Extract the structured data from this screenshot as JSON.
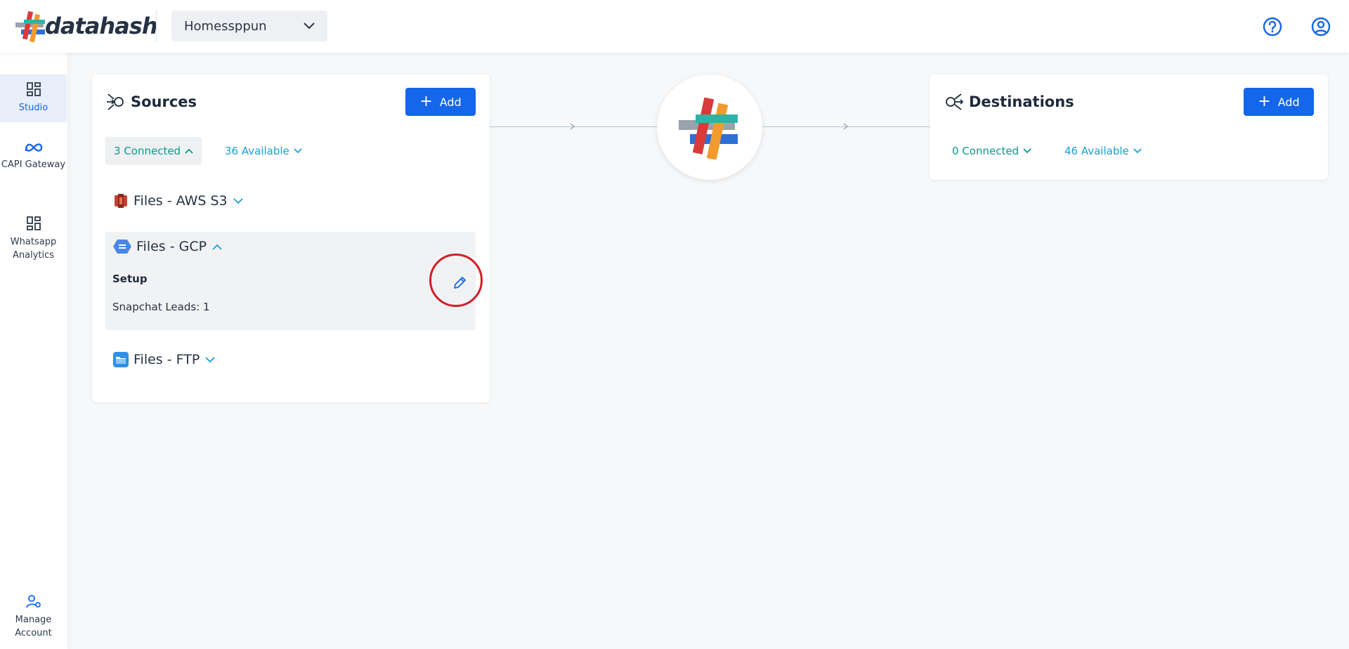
{
  "brand": {
    "name": "datahash"
  },
  "workspace": {
    "selected": "Homessppun"
  },
  "header": {
    "help_icon": "help-circle-icon",
    "account_icon": "user-circle-icon"
  },
  "sidebar": {
    "items": [
      {
        "label": "Studio",
        "icon": "dashboard-icon",
        "active": true
      },
      {
        "label": "CAPI Gateway",
        "icon": "meta-icon"
      },
      {
        "label": "Whatsapp Analytics",
        "icon": "dashboard-icon"
      },
      {
        "label": "Manage Account",
        "icon": "user-gear-icon"
      }
    ]
  },
  "sources": {
    "title": "Sources",
    "add_label": "Add",
    "connected_label": "3 Connected",
    "available_label": "36 Available",
    "items": [
      {
        "label": "Files - AWS S3",
        "expanded": false
      },
      {
        "label": "Files - GCP",
        "expanded": true,
        "setup_label": "Setup",
        "detail": "Snapchat Leads: 1"
      },
      {
        "label": "Files - FTP",
        "expanded": false
      }
    ]
  },
  "destinations": {
    "title": "Destinations",
    "add_label": "Add",
    "connected_label": "0 Connected",
    "available_label": "46 Available"
  },
  "colors": {
    "primary": "#1466ea",
    "teal": "#0e9a8a",
    "highlight": "#d01f2a"
  }
}
